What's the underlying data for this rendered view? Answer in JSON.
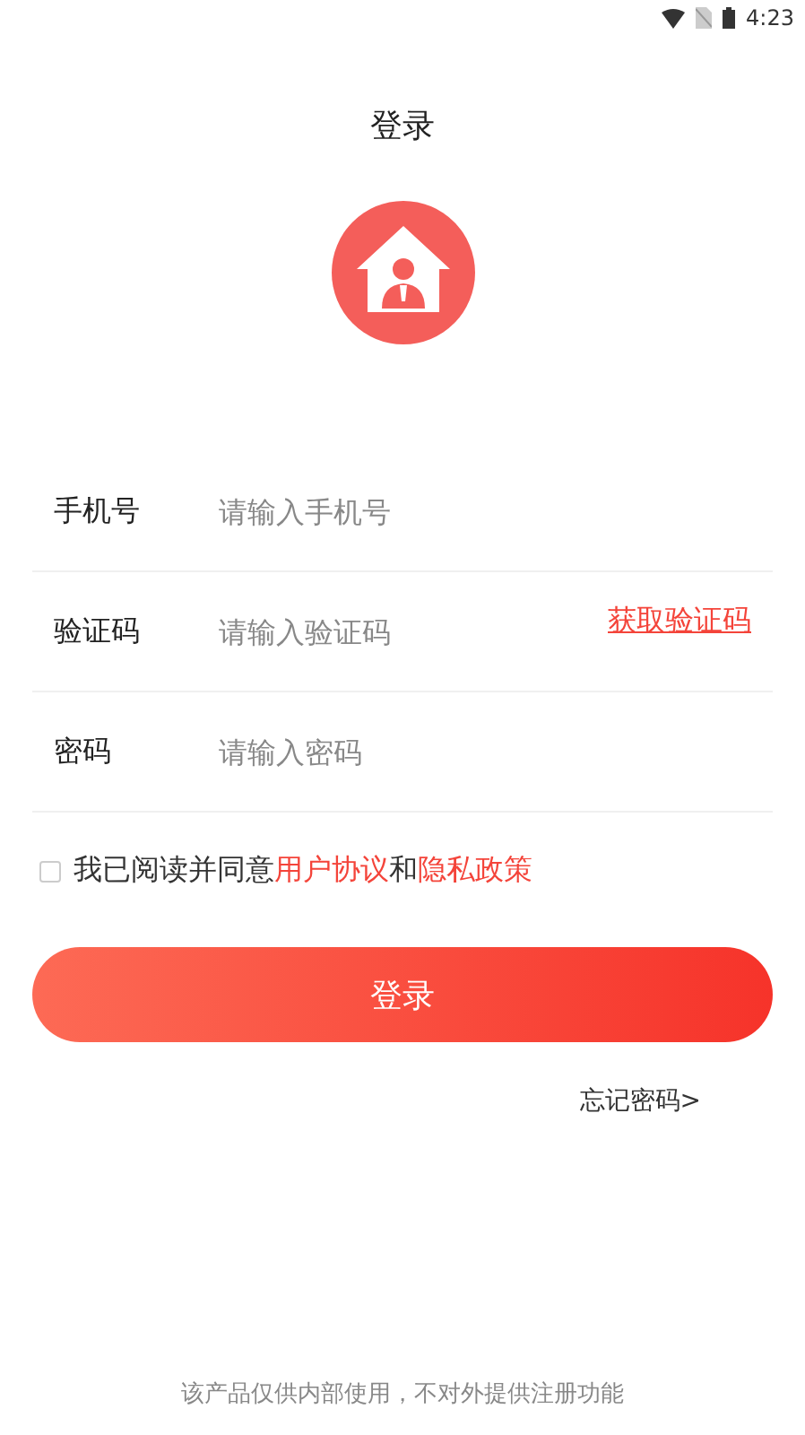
{
  "status_bar": {
    "time": "4:23"
  },
  "title": "登录",
  "fields": [
    {
      "label": "手机号",
      "placeholder": "请输入手机号"
    },
    {
      "label": "验证码",
      "placeholder": "请输入验证码",
      "action": "获取验证码"
    },
    {
      "label": "密码",
      "placeholder": "请输入密码"
    }
  ],
  "agreement": {
    "checked": false,
    "parts": [
      {
        "kind": "text",
        "text": "我已阅读并同意"
      },
      {
        "kind": "link",
        "text": "用户协议"
      },
      {
        "kind": "text",
        "text": "和"
      },
      {
        "kind": "link",
        "text": "隐私政策"
      }
    ]
  },
  "login_button": "登录",
  "forgot_password": "忘记密码>",
  "footer": "该产品仅供内部使用，不对外提供注册功能"
}
